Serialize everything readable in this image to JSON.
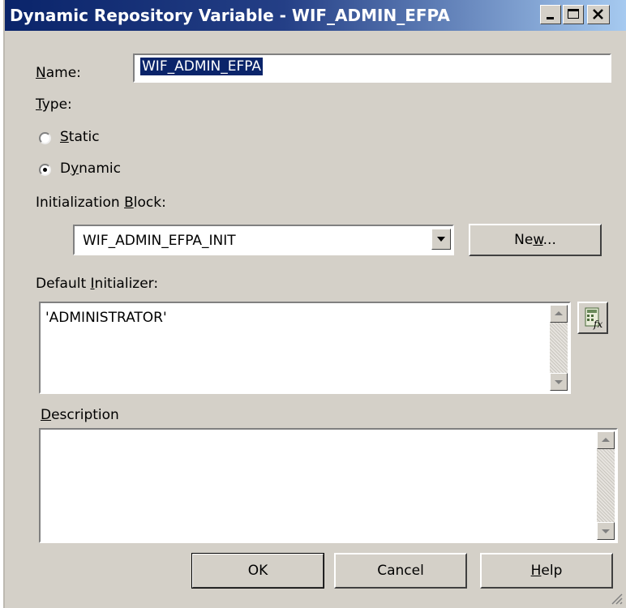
{
  "window": {
    "title": "Dynamic Repository Variable - WIF_ADMIN_EFPA",
    "controls": {
      "minimize_icon": "minimize-icon",
      "maximize_icon": "maximize-icon",
      "close_icon": "close-icon"
    }
  },
  "name": {
    "label_a": "N",
    "label_b": "ame:",
    "value": "WIF_ADMIN_EFPA"
  },
  "type": {
    "label_a": "T",
    "label_b": "ype:",
    "static": {
      "label_a": "S",
      "label_b": "tatic",
      "selected": false
    },
    "dynamic": {
      "label_a": "D",
      "label_u": "y",
      "label_b": "namic",
      "selected": true
    }
  },
  "init_block": {
    "label_a": "Initialization ",
    "label_u": "B",
    "label_b": "lock:",
    "selected": "WIF_ADMIN_EFPA_INIT",
    "new_button": {
      "label_a": "Ne",
      "label_u": "w",
      "label_b": "..."
    }
  },
  "default_initializer": {
    "label_a": "Default ",
    "label_u": "I",
    "label_b": "nitializer:",
    "value": "'ADMINISTRATOR'",
    "expression_builder_icon": "expression-builder-icon"
  },
  "description": {
    "label_a": "D",
    "label_b": "escription",
    "value": ""
  },
  "buttons": {
    "ok": "OK",
    "cancel": "Cancel",
    "help_a": "H",
    "help_b": "elp"
  },
  "colors": {
    "title_gradient_start": "#0a246a",
    "title_gradient_end": "#a6caf0",
    "dialog_face": "#d4d0c8",
    "selection": "#0a246a"
  }
}
